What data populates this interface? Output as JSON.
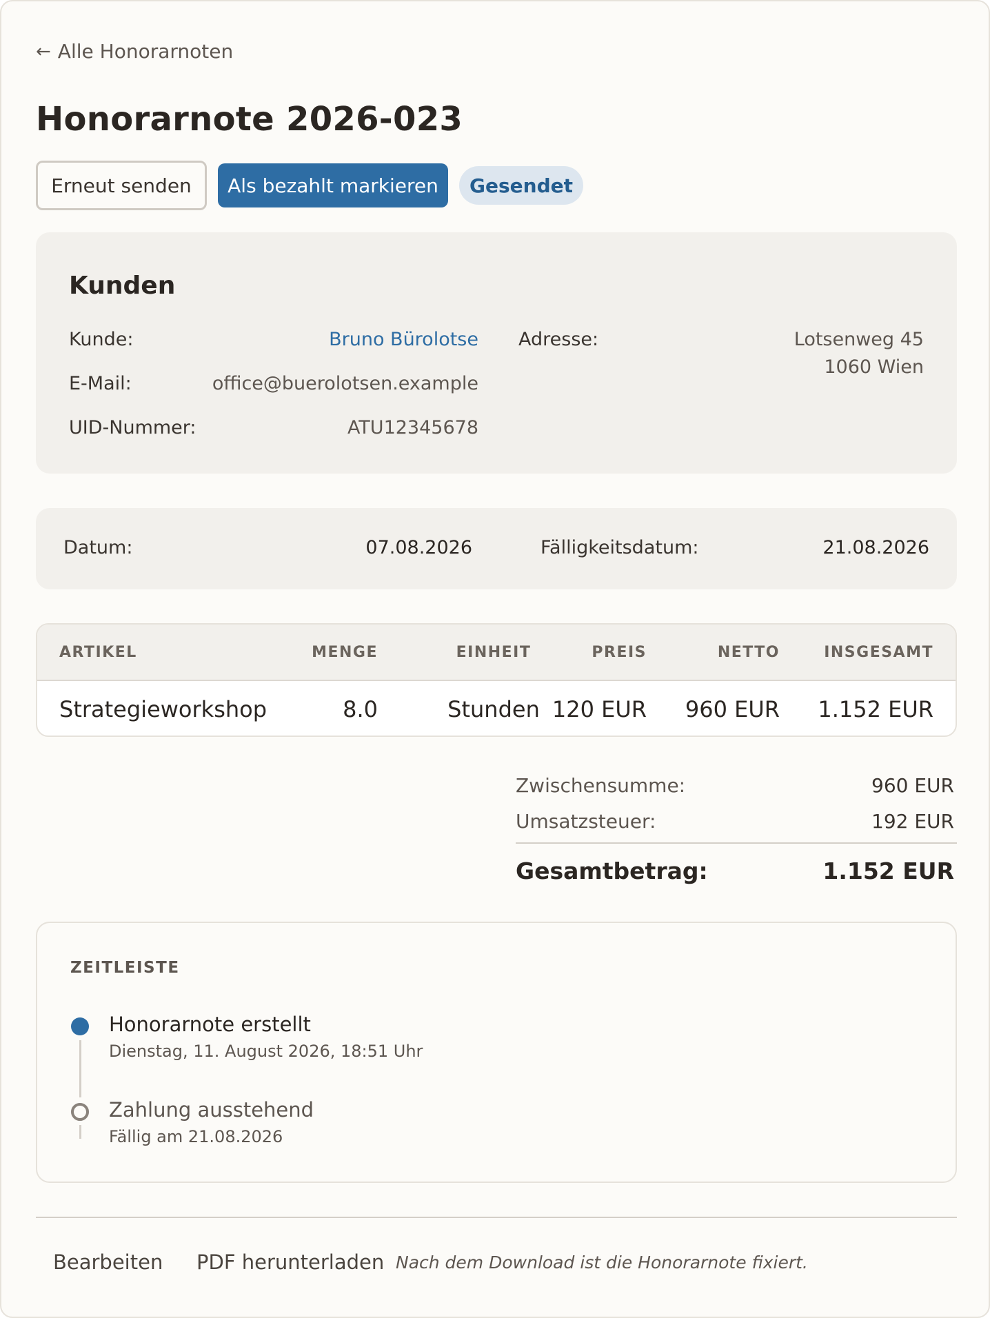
{
  "nav": {
    "back_arrow": "←",
    "back_label": "Alle Honorarnoten"
  },
  "header": {
    "title": "Honorarnote 2026-023"
  },
  "actions": {
    "resend_label": "Erneut senden",
    "mark_paid_label": "Als bezahlt markieren",
    "status_badge": "Gesendet"
  },
  "customer": {
    "heading": "Kunden",
    "customer_label": "Kunde:",
    "customer_name": "Bruno Bürolotse",
    "email_label": "E-Mail:",
    "email": "office@buerolotsen.example",
    "uid_label": "UID-Nummer:",
    "uid": "ATU12345678",
    "address_label": "Adresse:",
    "address_line1": "Lotsenweg 45",
    "address_line2": "1060 Wien"
  },
  "dates": {
    "date_label": "Datum:",
    "date": "07.08.2026",
    "due_label": "Fälligkeitsdatum:",
    "due_date": "21.08.2026"
  },
  "table": {
    "columns": [
      "ARTIKEL",
      "MENGE",
      "EINHEIT",
      "PREIS",
      "NETTO",
      "INSGESAMT"
    ],
    "rows": [
      {
        "artikel": "Strategieworkshop",
        "menge": "8.0",
        "einheit": "Stunden",
        "preis": "120 EUR",
        "netto": "960 EUR",
        "insgesamt": "1.152 EUR"
      }
    ]
  },
  "totals": {
    "subtotal_label": "Zwischensumme:",
    "subtotal": "960 EUR",
    "tax_label": "Umsatzsteuer:",
    "tax": "192 EUR",
    "grand_label": "Gesamtbetrag:",
    "grand": "1.152 EUR"
  },
  "timeline": {
    "title": "ZEITLEISTE",
    "events": [
      {
        "title": "Honorarnote erstellt",
        "subtitle": "Dienstag, 11. August 2026, 18:51 Uhr",
        "state": "done"
      },
      {
        "title": "Zahlung ausstehend",
        "subtitle": "Fällig am 21.08.2026",
        "state": "pending"
      }
    ]
  },
  "footer": {
    "edit_label": "Bearbeiten",
    "pdf_label": "PDF herunterladen",
    "note": "Nach dem Download ist die Honorarnote fixiert."
  },
  "colors": {
    "accent": "#2e6da4",
    "badge_bg": "#dde6ef",
    "panel_bg": "#f2f0ec",
    "page_bg": "#fcfbf8"
  }
}
